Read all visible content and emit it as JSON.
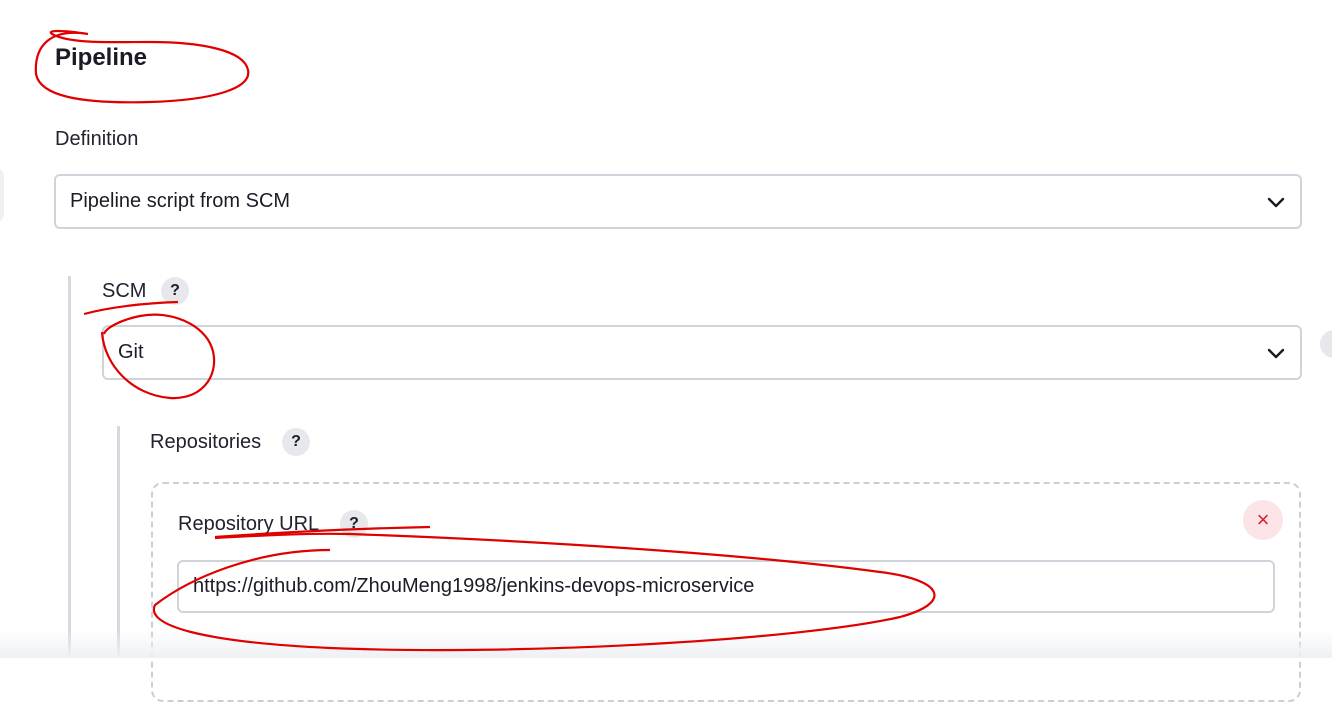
{
  "section": {
    "title": "Pipeline"
  },
  "definition": {
    "label": "Definition",
    "value": "Pipeline script from SCM"
  },
  "scm": {
    "label": "SCM",
    "help": "?",
    "value": "Git"
  },
  "repositories": {
    "label": "Repositories",
    "help": "?",
    "url_label": "Repository URL",
    "url_help": "?",
    "url_value": "https://github.com/ZhouMeng1998/jenkins-devops-microservice",
    "delete_glyph": "×"
  },
  "icons": {
    "chevron": "chevron-down-icon",
    "delete": "close-icon",
    "help": "question-mark-icon"
  },
  "colors": {
    "annotation": "#e00000",
    "danger": "#d6202f"
  }
}
